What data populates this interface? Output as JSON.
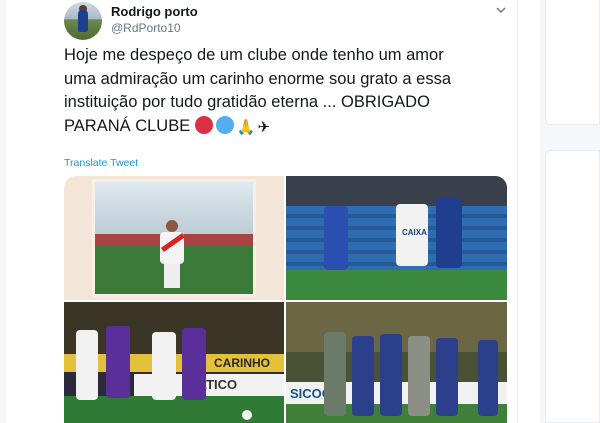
{
  "tweet": {
    "display_name": "Rodrigo porto",
    "handle": "@RdPorto10",
    "text_lines": [
      "Hoje me despeço de um clube onde tenho um amor",
      "uma admiração um carinho enorme sou grato a essa",
      "instituição por tudo gratidão eterna ... OBRIGADO",
      "PARANÁ CLUBE"
    ],
    "emoji_icons": [
      "red-circle-icon",
      "blue-circle-icon",
      "folded-hands-icon",
      "airplane-icon"
    ],
    "translate_label": "Translate Tweet",
    "menu_icon": "chevron-down-icon"
  },
  "photos": {
    "photo_1": {
      "logo": ""
    },
    "photo_2": {
      "sponsor": "CAIXA"
    },
    "photo_3": {
      "boards": [
        "CARINHO",
        "STATICO"
      ]
    },
    "photo_4": {
      "boards": [
        "SICOO"
      ]
    }
  },
  "colors": {
    "link": "#1b95e0",
    "text": "#14171a",
    "secondary": "#657786",
    "border": "#e6ecf0"
  }
}
